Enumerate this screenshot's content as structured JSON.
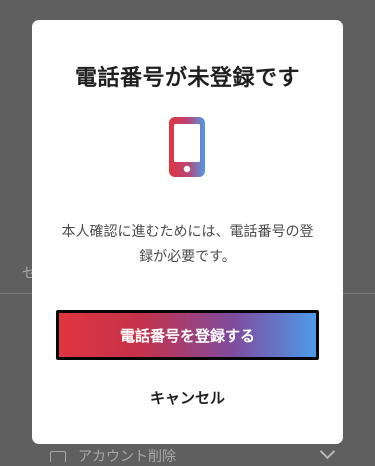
{
  "background": {
    "left_fragment": "セ",
    "bottom_row_label": "アカウント削除"
  },
  "modal": {
    "title": "電話番号が未登録です",
    "icon": "smartphone-icon",
    "message": "本人確認に進むためには、電話番号の登録が必要です。",
    "primary_button_label": "電話番号を登録する",
    "cancel_label": "キャンセル"
  },
  "colors": {
    "overlay": "#5f5f5f",
    "modal_bg": "#ffffff",
    "title": "#1f1f1f",
    "body_text": "#4a4a4a",
    "gradient_start": "#e0353f",
    "gradient_end": "#4d9be9",
    "button_border": "#050505"
  }
}
